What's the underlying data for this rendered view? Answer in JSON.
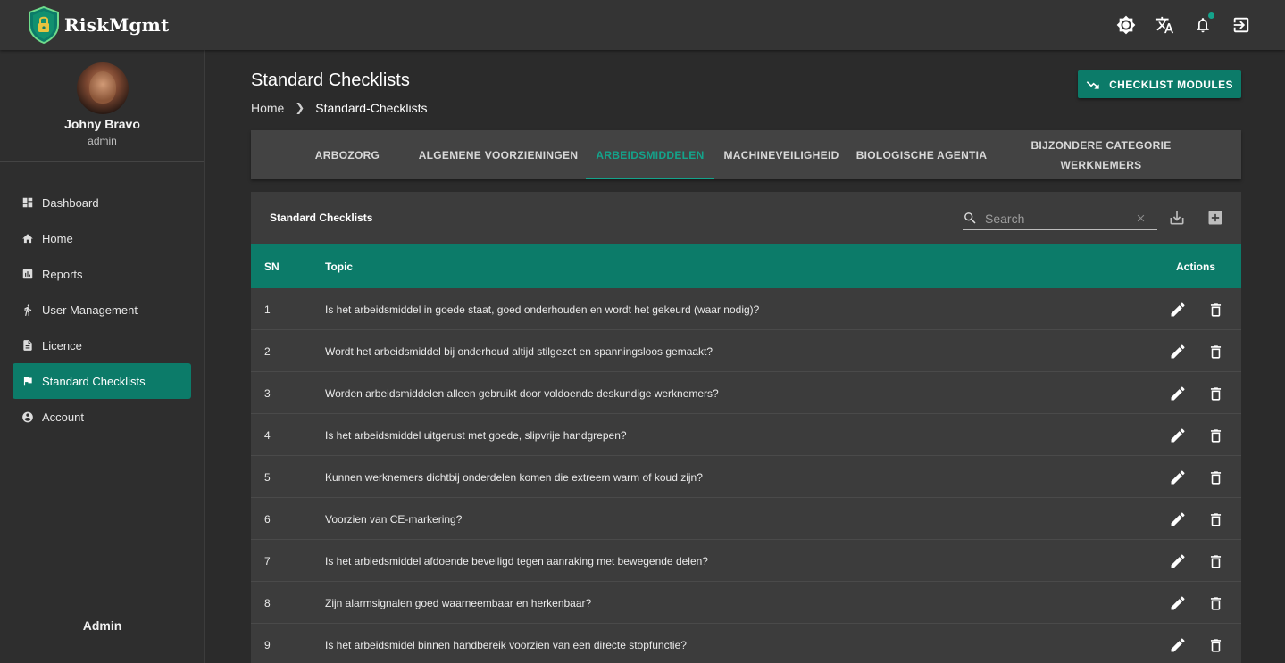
{
  "app": {
    "logo_text": "RiskMgmt"
  },
  "topbar": {
    "icons": [
      "theme-icon",
      "translate-icon",
      "notifications-icon",
      "logout-icon"
    ]
  },
  "user": {
    "name": "Johny Bravo",
    "role": "admin"
  },
  "sidebar": {
    "items": [
      {
        "label": "Dashboard",
        "icon": "dashboard-icon"
      },
      {
        "label": "Home",
        "icon": "home-icon"
      },
      {
        "label": "Reports",
        "icon": "reports-icon"
      },
      {
        "label": "User Management",
        "icon": "user-management-icon"
      },
      {
        "label": "Licence",
        "icon": "licence-icon"
      },
      {
        "label": "Standard Checklists",
        "icon": "flag-icon",
        "active": true
      },
      {
        "label": "Account",
        "icon": "account-icon"
      }
    ],
    "footer": "Admin"
  },
  "page": {
    "title": "Standard Checklists",
    "breadcrumb": [
      "Home",
      "Standard-Checklists"
    ],
    "modules_button": "CHECKLIST MODULES"
  },
  "tabs": [
    {
      "label": "ARBOZORG"
    },
    {
      "label": "ALGEMENE VOORZIENINGEN"
    },
    {
      "label": "ARBEIDSMIDDELEN",
      "active": true
    },
    {
      "label": "MACHINEVEILIGHEID"
    },
    {
      "label": "BIOLOGISCHE AGENTIA"
    },
    {
      "label": "BIJZONDERE CATEGORIE WERKNEMERS"
    }
  ],
  "table": {
    "title": "Standard Checklists",
    "search_placeholder": "Search",
    "columns": {
      "sn": "SN",
      "topic": "Topic",
      "actions": "Actions"
    },
    "rows": [
      {
        "sn": "1",
        "topic": "Is het arbeidsmiddel in goede staat, goed onderhouden en wordt het gekeurd (waar nodig)?"
      },
      {
        "sn": "2",
        "topic": "Wordt het arbeidsmiddel bij onderhoud altijd stilgezet en spanningsloos gemaakt?"
      },
      {
        "sn": "3",
        "topic": "Worden arbeidsmiddelen alleen gebruikt door voldoende deskundige werknemers?"
      },
      {
        "sn": "4",
        "topic": "Is het arbeidsmiddel uitgerust met goede, slipvrije handgrepen?"
      },
      {
        "sn": "5",
        "topic": "Kunnen werknemers dichtbij onderdelen komen die extreem warm of koud zijn?"
      },
      {
        "sn": "6",
        "topic": "Voorzien van CE-markering?"
      },
      {
        "sn": "7",
        "topic": "Is het arbiedsmiddel afdoende beveiligd tegen aanraking met bewegende delen?"
      },
      {
        "sn": "8",
        "topic": "Zijn alarmsignalen goed waarneembaar en herkenbaar?"
      },
      {
        "sn": "9",
        "topic": "Is het arbeidsmidel binnen handbereik voorzien van een directe stopfunctie?"
      }
    ]
  },
  "colors": {
    "accent": "#0c7b69",
    "accent_light": "#14a38b",
    "background": "#2b2b2b",
    "card": "#3c3c3c"
  }
}
